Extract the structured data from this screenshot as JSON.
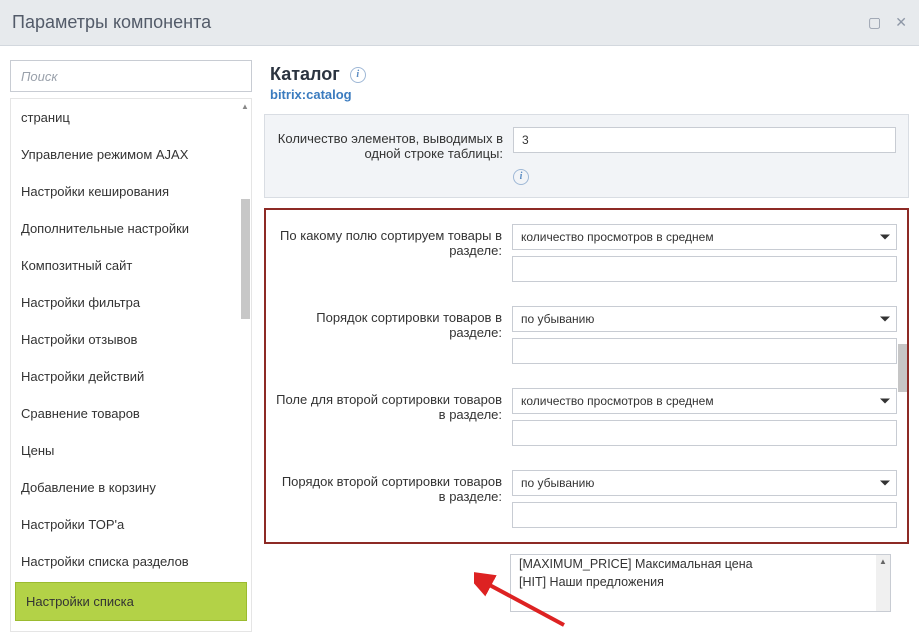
{
  "window": {
    "title": "Параметры компонента"
  },
  "sidebar": {
    "search_placeholder": "Поиск",
    "items": [
      {
        "label": "страниц"
      },
      {
        "label": "Управление режимом AJAX"
      },
      {
        "label": "Настройки кеширования"
      },
      {
        "label": "Дополнительные настройки"
      },
      {
        "label": "Композитный сайт"
      },
      {
        "label": "Настройки фильтра"
      },
      {
        "label": "Настройки отзывов"
      },
      {
        "label": "Настройки действий"
      },
      {
        "label": "Сравнение товаров"
      },
      {
        "label": "Цены"
      },
      {
        "label": "Добавление в корзину"
      },
      {
        "label": "Настройки ТОР'а"
      },
      {
        "label": "Настройки списка разделов"
      },
      {
        "label": "Настройки списка",
        "active": true
      }
    ]
  },
  "component": {
    "title": "Каталог",
    "name": "bitrix:catalog"
  },
  "form": {
    "count_label": "Количество элементов, выводимых в одной строке таблицы:",
    "count_value": "3",
    "sort1_field_label": "По какому полю сортируем товары в разделе:",
    "sort1_field_value": "количество просмотров в среднем",
    "sort1_order_label": "Порядок сортировки товаров в разделе:",
    "sort1_order_value": "по убыванию",
    "sort2_field_label": "Поле для второй сортировки товаров в разделе:",
    "sort2_field_value": "количество просмотров в среднем",
    "sort2_order_label": "Порядок второй сортировки товаров в разделе:",
    "sort2_order_value": "по убыванию",
    "listbox": {
      "line1": "[MAXIMUM_PRICE] Максимальная цена",
      "line2": "[HIT] Наши предложения"
    }
  }
}
